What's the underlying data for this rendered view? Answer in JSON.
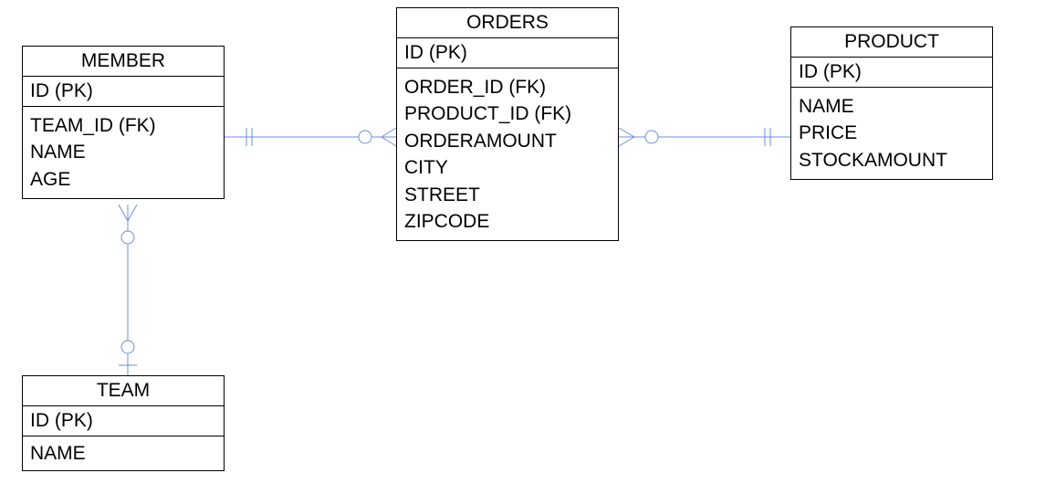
{
  "entities": {
    "member": {
      "title": "MEMBER",
      "pk": "ID (PK)",
      "fields": [
        "TEAM_ID (FK)",
        "NAME",
        "AGE"
      ]
    },
    "orders": {
      "title": "ORDERS",
      "pk": "ID (PK)",
      "fields": [
        "ORDER_ID (FK)",
        "PRODUCT_ID (FK)",
        "ORDERAMOUNT",
        "CITY",
        "STREET",
        "ZIPCODE"
      ]
    },
    "product": {
      "title": "PRODUCT",
      "pk": "ID (PK)",
      "fields": [
        "NAME",
        "PRICE",
        "STOCKAMOUNT"
      ]
    },
    "team": {
      "title": "TEAM",
      "pk": "ID (PK)",
      "fields": [
        "NAME"
      ]
    }
  }
}
